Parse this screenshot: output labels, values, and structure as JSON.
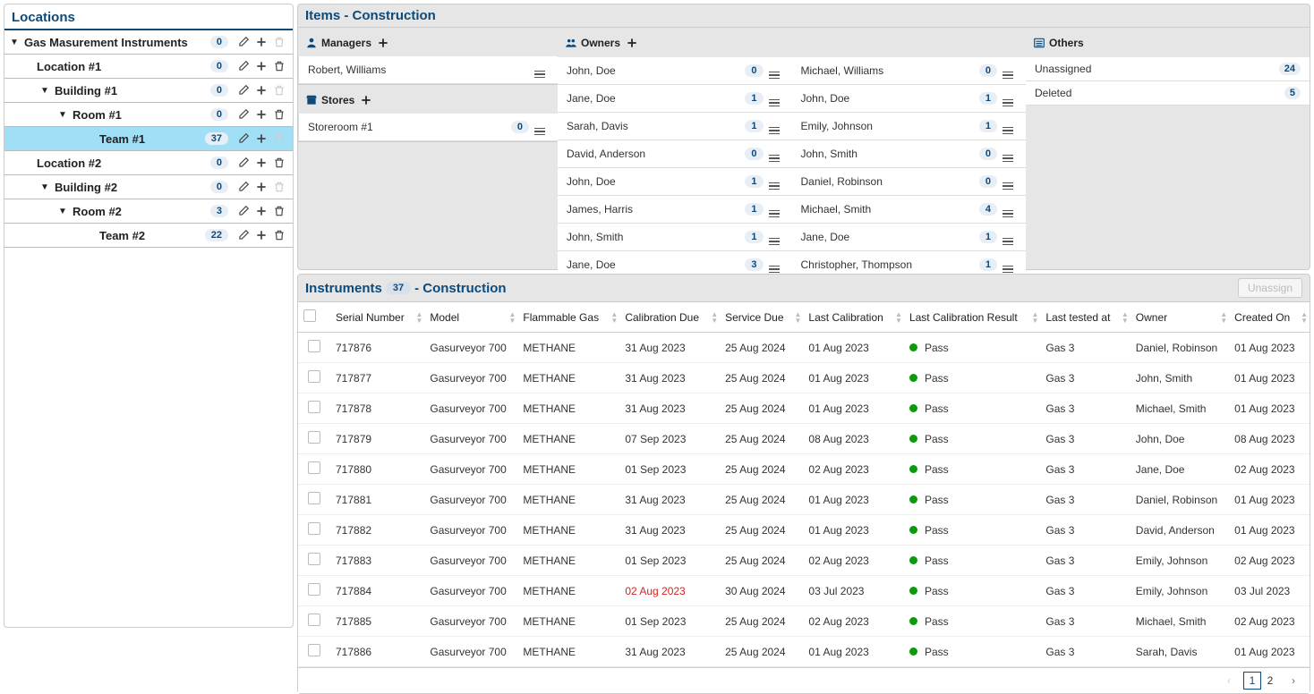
{
  "locations": {
    "title": "Locations",
    "tree": [
      {
        "label": "Gas Masurement Instruments",
        "count": 0,
        "level": 0,
        "expanded": true,
        "editable": true,
        "addable": true,
        "deletable": false
      },
      {
        "label": "Location #1",
        "count": 0,
        "level": 1,
        "expanded": false,
        "editable": true,
        "addable": true,
        "deletable": true
      },
      {
        "label": "Building #1",
        "count": 0,
        "level": 2,
        "expanded": true,
        "editable": true,
        "addable": true,
        "deletable": false
      },
      {
        "label": "Room #1",
        "count": 0,
        "level": 3,
        "expanded": true,
        "editable": true,
        "addable": true,
        "deletable": true
      },
      {
        "label": "Team #1",
        "count": 37,
        "level": 4,
        "expanded": false,
        "editable": true,
        "addable": true,
        "deletable": false,
        "selected": true
      },
      {
        "label": "Location #2",
        "count": 0,
        "level": 1,
        "expanded": false,
        "editable": true,
        "addable": true,
        "deletable": true
      },
      {
        "label": "Building #2",
        "count": 0,
        "level": 2,
        "expanded": true,
        "editable": true,
        "addable": true,
        "deletable": false
      },
      {
        "label": "Room #2",
        "count": 3,
        "level": 3,
        "expanded": true,
        "editable": true,
        "addable": true,
        "deletable": true
      },
      {
        "label": "Team #2",
        "count": 22,
        "level": 4,
        "expanded": false,
        "editable": true,
        "addable": true,
        "deletable": true
      }
    ]
  },
  "items": {
    "title": "Items - Construction",
    "managers_label": "Managers",
    "managers": [
      {
        "name": "Robert, Williams",
        "count": null
      }
    ],
    "stores_label": "Stores",
    "stores": [
      {
        "name": "Storeroom #1",
        "count": 0
      }
    ],
    "owners_label": "Owners",
    "owners_left": [
      {
        "name": "John, Doe",
        "count": 0
      },
      {
        "name": "Jane, Doe",
        "count": 1
      },
      {
        "name": "Sarah, Davis",
        "count": 1
      },
      {
        "name": "David, Anderson",
        "count": 0
      },
      {
        "name": "John, Doe",
        "count": 1
      },
      {
        "name": "James, Harris",
        "count": 1
      },
      {
        "name": "John, Smith",
        "count": 1
      },
      {
        "name": "Jane, Doe",
        "count": 3
      }
    ],
    "owners_right": [
      {
        "name": "Michael, Williams",
        "count": 0
      },
      {
        "name": "John, Doe",
        "count": 1
      },
      {
        "name": "Emily, Johnson",
        "count": 1
      },
      {
        "name": "John, Smith",
        "count": 0
      },
      {
        "name": "Daniel, Robinson",
        "count": 0
      },
      {
        "name": "Michael, Smith",
        "count": 4
      },
      {
        "name": "Jane, Doe",
        "count": 1
      },
      {
        "name": "Christopher, Thompson",
        "count": 1
      }
    ],
    "others_label": "Others",
    "others": [
      {
        "name": "Unassigned",
        "count": 24
      },
      {
        "name": "Deleted",
        "count": 5
      }
    ]
  },
  "instruments": {
    "title": "Instruments",
    "count": 37,
    "subtitle": "- Construction",
    "unassign_label": "Unassign",
    "columns": [
      "Serial Number",
      "Model",
      "Flammable Gas",
      "Calibration Due",
      "Service Due",
      "Last Calibration",
      "Last Calibration Result",
      "Last tested at",
      "Owner",
      "Created On"
    ],
    "rows": [
      {
        "serial": "717876",
        "model": "Gasurveyor 700",
        "gas": "METHANE",
        "cal_due": "31 Aug 2023",
        "srv_due": "25 Aug 2024",
        "last_cal": "01 Aug 2023",
        "result": "Pass",
        "tested": "Gas 3",
        "owner": "Daniel, Robinson",
        "created": "01 Aug 2023",
        "overdue": false
      },
      {
        "serial": "717877",
        "model": "Gasurveyor 700",
        "gas": "METHANE",
        "cal_due": "31 Aug 2023",
        "srv_due": "25 Aug 2024",
        "last_cal": "01 Aug 2023",
        "result": "Pass",
        "tested": "Gas 3",
        "owner": "John, Smith",
        "created": "01 Aug 2023",
        "overdue": false
      },
      {
        "serial": "717878",
        "model": "Gasurveyor 700",
        "gas": "METHANE",
        "cal_due": "31 Aug 2023",
        "srv_due": "25 Aug 2024",
        "last_cal": "01 Aug 2023",
        "result": "Pass",
        "tested": "Gas 3",
        "owner": "Michael, Smith",
        "created": "01 Aug 2023",
        "overdue": false
      },
      {
        "serial": "717879",
        "model": "Gasurveyor 700",
        "gas": "METHANE",
        "cal_due": "07 Sep 2023",
        "srv_due": "25 Aug 2024",
        "last_cal": "08 Aug 2023",
        "result": "Pass",
        "tested": "Gas 3",
        "owner": "John, Doe",
        "created": "08 Aug 2023",
        "overdue": false
      },
      {
        "serial": "717880",
        "model": "Gasurveyor 700",
        "gas": "METHANE",
        "cal_due": "01 Sep 2023",
        "srv_due": "25 Aug 2024",
        "last_cal": "02 Aug 2023",
        "result": "Pass",
        "tested": "Gas 3",
        "owner": "Jane, Doe",
        "created": "02 Aug 2023",
        "overdue": false
      },
      {
        "serial": "717881",
        "model": "Gasurveyor 700",
        "gas": "METHANE",
        "cal_due": "31 Aug 2023",
        "srv_due": "25 Aug 2024",
        "last_cal": "01 Aug 2023",
        "result": "Pass",
        "tested": "Gas 3",
        "owner": "Daniel, Robinson",
        "created": "01 Aug 2023",
        "overdue": false
      },
      {
        "serial": "717882",
        "model": "Gasurveyor 700",
        "gas": "METHANE",
        "cal_due": "31 Aug 2023",
        "srv_due": "25 Aug 2024",
        "last_cal": "01 Aug 2023",
        "result": "Pass",
        "tested": "Gas 3",
        "owner": "David, Anderson",
        "created": "01 Aug 2023",
        "overdue": false
      },
      {
        "serial": "717883",
        "model": "Gasurveyor 700",
        "gas": "METHANE",
        "cal_due": "01 Sep 2023",
        "srv_due": "25 Aug 2024",
        "last_cal": "02 Aug 2023",
        "result": "Pass",
        "tested": "Gas 3",
        "owner": "Emily, Johnson",
        "created": "02 Aug 2023",
        "overdue": false
      },
      {
        "serial": "717884",
        "model": "Gasurveyor 700",
        "gas": "METHANE",
        "cal_due": "02 Aug 2023",
        "srv_due": "30 Aug 2024",
        "last_cal": "03 Jul 2023",
        "result": "Pass",
        "tested": "Gas 3",
        "owner": "Emily, Johnson",
        "created": "03 Jul 2023",
        "overdue": true
      },
      {
        "serial": "717885",
        "model": "Gasurveyor 700",
        "gas": "METHANE",
        "cal_due": "01 Sep 2023",
        "srv_due": "25 Aug 2024",
        "last_cal": "02 Aug 2023",
        "result": "Pass",
        "tested": "Gas 3",
        "owner": "Michael, Smith",
        "created": "02 Aug 2023",
        "overdue": false
      },
      {
        "serial": "717886",
        "model": "Gasurveyor 700",
        "gas": "METHANE",
        "cal_due": "31 Aug 2023",
        "srv_due": "25 Aug 2024",
        "last_cal": "01 Aug 2023",
        "result": "Pass",
        "tested": "Gas 3",
        "owner": "Sarah, Davis",
        "created": "01 Aug 2023",
        "overdue": false
      }
    ],
    "pagination": {
      "current": 1,
      "pages": [
        1,
        2
      ]
    }
  }
}
